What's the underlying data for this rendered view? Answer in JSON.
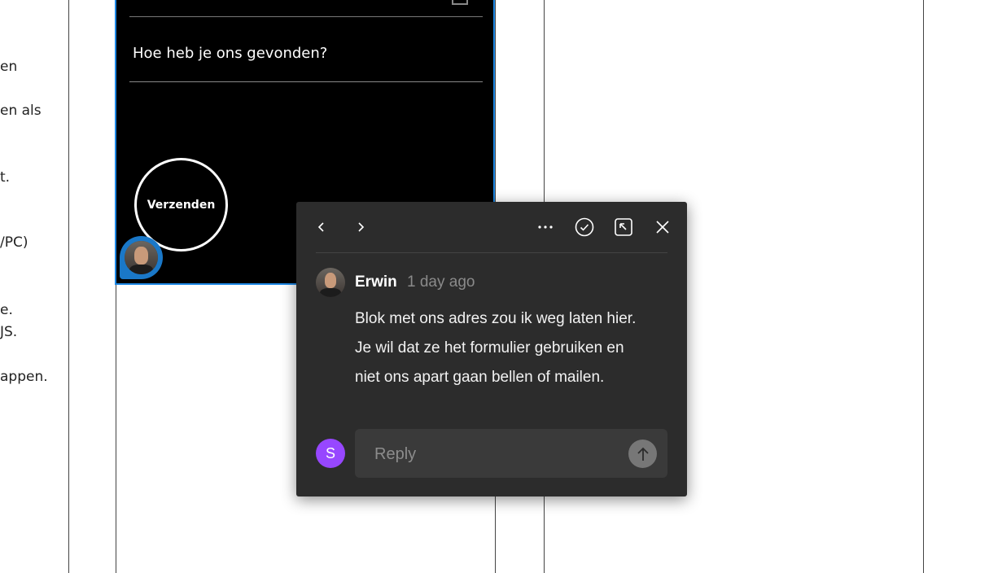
{
  "background_fragments": [
    "en",
    "en als",
    "t.",
    "/PC)",
    "e.",
    "JS.",
    "appen."
  ],
  "form": {
    "question": "Hoe heb je ons gevonden?",
    "submit_label": "Verzenden"
  },
  "comment": {
    "author": "Erwin",
    "time_ago": "1 day ago",
    "body": "Blok met ons adres zou ik weg laten hier. Je wil dat ze het formulier gebruiken en niet ons apart gaan bellen of mailen."
  },
  "reply": {
    "user_initial": "S",
    "placeholder": "Reply"
  },
  "colors": {
    "selection": "#1e88e5",
    "popup_bg": "#2c2c2c",
    "reply_avatar": "#9747ff"
  },
  "icons": {
    "prev": "chevron-left-icon",
    "next": "chevron-right-icon",
    "more": "more-icon",
    "resolve": "check-circle-icon",
    "jump": "jump-to-icon",
    "close": "close-icon",
    "send": "arrow-up-icon"
  }
}
